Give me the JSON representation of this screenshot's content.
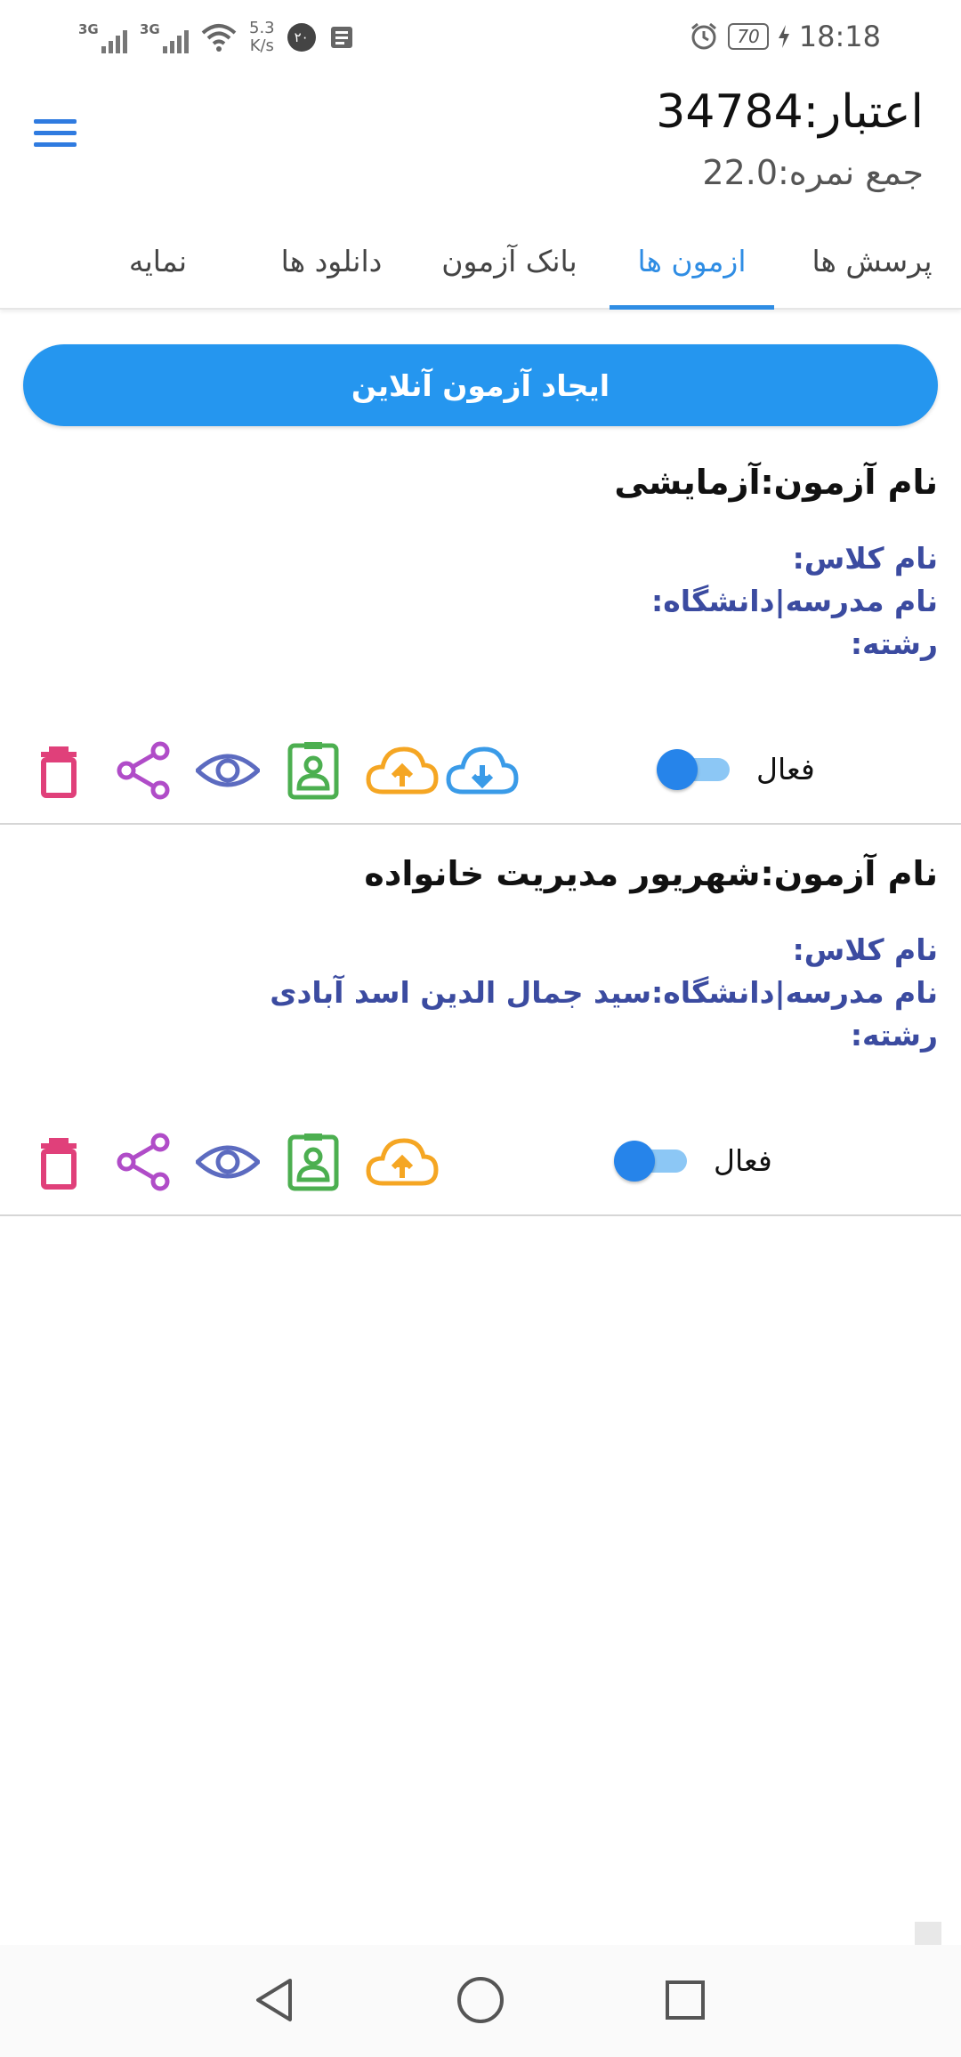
{
  "status_bar": {
    "network_1": "3G",
    "network_2": "3G",
    "speed_value": "5.3",
    "speed_unit": "K/s",
    "notification_badge": "۲۰",
    "battery": "70",
    "time": "18:18"
  },
  "header": {
    "credit": "اعتبار:34784",
    "score": "جمع نمره:22.0"
  },
  "tabs": [
    {
      "label": "پرسش ها",
      "active": false
    },
    {
      "label": "ازمون ها",
      "active": true
    },
    {
      "label": "بانک آزمون",
      "active": false
    },
    {
      "label": "دانلود ها",
      "active": false
    },
    {
      "label": "نمایه",
      "active": false
    }
  ],
  "create_button": {
    "label": "ایجاد آزمون آنلاین"
  },
  "exams": [
    {
      "title": "نام آزمون:آزمایشی",
      "class": "نام کلاس:",
      "school": "نام مدرسه|دانشگاه:",
      "field": "رشته:",
      "active_label": "فعال",
      "has_download": true
    },
    {
      "title": "نام آزمون:شهریور مدیریت خانواده",
      "class": "نام کلاس:",
      "school": "نام مدرسه|دانشگاه:سید جمال الدین اسد آبادی",
      "field": "رشته:",
      "active_label": "فعال",
      "has_download": false
    }
  ],
  "colors": {
    "accent": "#2f8de4",
    "button": "#2596ef",
    "info_text": "#3b4ba0",
    "delete": "#e0407a",
    "share": "#b04cc8",
    "view": "#5c6bc0",
    "contact": "#4caf50",
    "upload": "#f5a623",
    "download": "#3a9be8"
  },
  "icons": [
    "menu-icon",
    "delete-icon",
    "share-icon",
    "eye-icon",
    "contact-card-icon",
    "cloud-upload-icon",
    "cloud-download-icon",
    "back-icon",
    "home-icon",
    "recents-icon"
  ]
}
